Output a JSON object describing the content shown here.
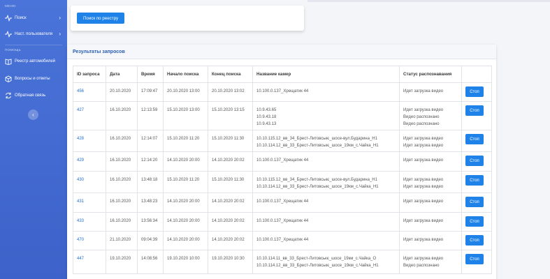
{
  "sidebar": {
    "section_menu": "МЕНЮ",
    "section_pages": "ПОМОЩЬ",
    "items": [
      {
        "label": "Поиск",
        "icon": "activity-icon",
        "chevron": "›"
      },
      {
        "label": "Наст. пользователя",
        "icon": "activity-icon",
        "chevron": "›"
      },
      {
        "label": "Реестр автомобилей",
        "icon": "book-icon"
      },
      {
        "label": "Вопросы и ответы",
        "icon": "box-icon"
      },
      {
        "label": "Обратная связь",
        "icon": "refresh-icon"
      }
    ],
    "collapse_glyph": "‹"
  },
  "search_card": {
    "button_label": "Поиск по реестру"
  },
  "results": {
    "title": "Результаты запросов",
    "columns": [
      "ID запроса",
      "Дата",
      "Время",
      "Начало поиска",
      "Конец поиска",
      "Название камер",
      "Статус распознавания"
    ],
    "action_label": "Стоп",
    "rows": [
      {
        "id": "456",
        "date": "20.10.2020",
        "time": "17:09:47",
        "start": "20.10.2020 13:00",
        "end": "20.10.2020 13:02",
        "cameras": [
          "10.100.0.137_Хрещатик 44"
        ],
        "status": [
          "Идет загрузка видео"
        ]
      },
      {
        "id": "427",
        "date": "16.10.2020",
        "time": "12:13:59",
        "start": "15.10.2020 13:00",
        "end": "15.10.2020 13:15",
        "cameras": [
          "10.9.43.65",
          "10.9.43.18",
          "10.9.43.13"
        ],
        "status": [
          "Идет загрузка видео",
          "Видео распознано",
          "Видео распознано"
        ]
      },
      {
        "id": "428",
        "date": "16.10.2020",
        "time": "12:14:07",
        "start": "15.10.2020 11:20",
        "end": "15.10.2020 11:30",
        "cameras": [
          "10.10.115.12_вв_34_Брест-Литовськє_шосе-вул.Бударина_Н1",
          "10.10.114.12_вв_33_Брест-Литовськє_шосе_19км_с.Чайка_Н1"
        ],
        "status": [
          "Идет загрузка видео",
          "Идет загрузка видео"
        ]
      },
      {
        "id": "429",
        "date": "16.10.2020",
        "time": "12:14:20",
        "start": "14.10.2020 20:00",
        "end": "14.10.2020 20:02",
        "cameras": [
          "10.100.0.137_Хрещатик 44"
        ],
        "status": [
          "Идет загрузка видео"
        ]
      },
      {
        "id": "430",
        "date": "16.10.2020",
        "time": "13:48:18",
        "start": "15.10.2020 11:20",
        "end": "15.10.2020 11:30",
        "cameras": [
          "10.10.115.12_вв_34_Брест-Литовськє_шосе-вул.Бударина_Н1",
          "10.10.114.12_вв_33_Брест-Литовськє_шосе_19км_с.Чайка_Н1"
        ],
        "status": [
          "Идет загрузка видео",
          "Идет загрузка видео"
        ]
      },
      {
        "id": "431",
        "date": "16.10.2020",
        "time": "13:48:23",
        "start": "14.10.2020 20:00",
        "end": "14.10.2020 20:02",
        "cameras": [
          "10.100.0.137_Хрещатик 44"
        ],
        "status": [
          "Идет загрузка видео"
        ]
      },
      {
        "id": "433",
        "date": "16.10.2020",
        "time": "13:56:34",
        "start": "14.10.2020 20:00",
        "end": "14.10.2020 20:02",
        "cameras": [
          "10.100.0.137_Хрещатик 44"
        ],
        "status": [
          "Идет загрузка видео"
        ]
      },
      {
        "id": "470",
        "date": "21.10.2020",
        "time": "09:04:39",
        "start": "14.10.2020 20:00",
        "end": "14.10.2020 20:02",
        "cameras": [
          "10.100.0.137_Хрещатик 44"
        ],
        "status": [
          "Идет загрузка видео"
        ]
      },
      {
        "id": "447",
        "date": "19.10.2020",
        "time": "14:08:56",
        "start": "19.10.2020 10:00",
        "end": "19.10.2020 10:30",
        "cameras": [
          "10.10.114.11_вв_33_Брест-Литовськє_шосе_19км_с.Чайка_О",
          "10.10.114.12_вв_33_Брест-Литовськє_шосе_19км_с.Чайка_Н1"
        ],
        "status": [
          "Идет загрузка видео",
          "Видео распознано"
        ]
      }
    ]
  },
  "colors": {
    "sidebar": "#4a74d9",
    "accent": "#1e82e8",
    "link": "#1f6fd1",
    "title": "#2a5fb0"
  }
}
